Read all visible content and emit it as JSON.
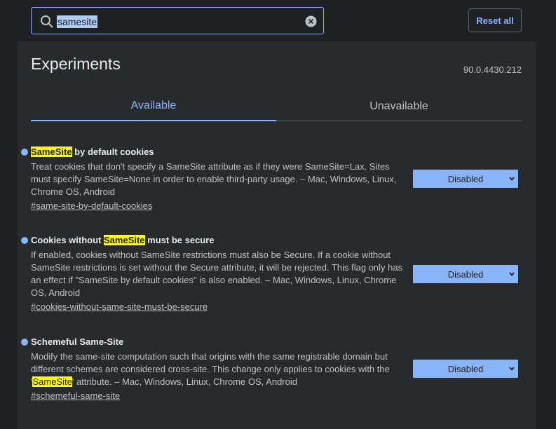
{
  "search": {
    "value": "samesite"
  },
  "header": {
    "reset_label": "Reset all",
    "title": "Experiments",
    "version": "90.0.4430.212"
  },
  "tabs": [
    {
      "label": "Available",
      "active": true
    },
    {
      "label": "Unavailable",
      "active": false
    }
  ],
  "experiments": [
    {
      "title_pre": "",
      "title_hl": "SameSite",
      "title_post": " by default cookies",
      "desc_pre": "Treat cookies that don't specify a SameSite attribute as if they were SameSite=Lax. Sites must specify SameSite=None in order to enable third-party usage. – Mac, Windows, Linux, Chrome OS, Android",
      "desc_hl": "",
      "desc_post": "",
      "link": "#same-site-by-default-cookies",
      "value": "Disabled"
    },
    {
      "title_pre": "Cookies without ",
      "title_hl": "SameSite",
      "title_post": " must be secure",
      "desc_pre": "If enabled, cookies without SameSite restrictions must also be Secure. If a cookie without SameSite restrictions is set without the Secure attribute, it will be rejected. This flag only has an effect if \"SameSite by default cookies\" is also enabled. – Mac, Windows, Linux, Chrome OS, Android",
      "desc_hl": "",
      "desc_post": "",
      "link": "#cookies-without-same-site-must-be-secure",
      "value": "Disabled"
    },
    {
      "title_pre": "Schemeful Same-Site",
      "title_hl": "",
      "title_post": "",
      "desc_pre": "Modify the same-site computation such that origins with the same registrable domain but different schemes are considered cross-site. This change only applies to cookies with the '",
      "desc_hl": "SameSite",
      "desc_post": "' attribute. – Mac, Windows, Linux, Chrome OS, Android",
      "link": "#schemeful-same-site",
      "value": "Disabled"
    }
  ],
  "colors": {
    "accent": "#8ab4f8",
    "highlight": "#ffff00",
    "background": "#202124",
    "panel": "#292a2d"
  },
  "icons": {
    "search": "search-icon",
    "clear": "clear-icon",
    "dropdown": "chevron-down-icon"
  }
}
